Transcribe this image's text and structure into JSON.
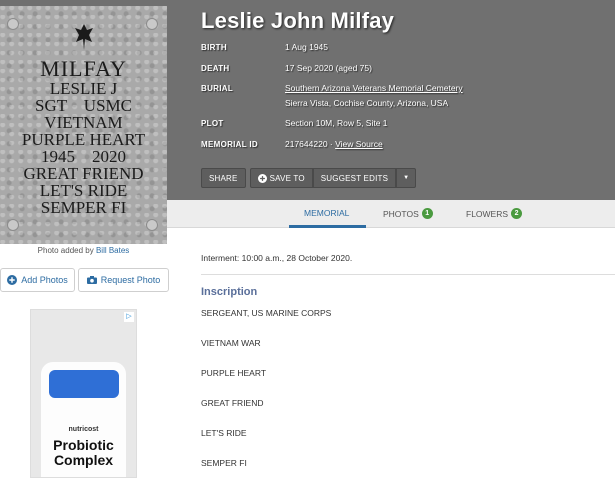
{
  "memorial": {
    "name": "Leslie John Milfay",
    "facts": [
      {
        "label": "BIRTH",
        "value": "1 Aug 1945"
      },
      {
        "label": "DEATH",
        "value": "17 Sep 2020 (aged 75)"
      },
      {
        "label": "BURIAL",
        "value": "Southern Arizona Veterans Memorial Cemetery",
        "value2": "Sierra Vista, Cochise County, Arizona, USA"
      },
      {
        "label": "PLOT",
        "value": "Section 10M, Row 5, Site 1"
      },
      {
        "label": "MEMORIAL ID",
        "value": "217644220",
        "link": "View Source"
      }
    ]
  },
  "toolbar": {
    "share": "SHARE",
    "save": "SAVE TO",
    "suggest": "SUGGEST EDITS"
  },
  "photo": {
    "headstone": [
      "MILFAY",
      "LESLIE J",
      "SGT    USMC",
      "VIETNAM",
      "PURPLE HEART",
      "1945    2020",
      "GREAT FRIEND",
      "LET'S RIDE",
      "SEMPER FI"
    ],
    "credit_prefix": "Photo added by",
    "credit_name": "Bill Bates",
    "add_photos": "Add Photos",
    "request_photo": "Request Photo"
  },
  "ad": {
    "brand": "nutricost",
    "title": "Probiotic Complex"
  },
  "tabs": [
    {
      "label": "MEMORIAL",
      "count": null,
      "active": true
    },
    {
      "label": "PHOTOS",
      "count": "1",
      "active": false
    },
    {
      "label": "FLOWERS",
      "count": "2",
      "active": false
    }
  ],
  "content": {
    "interment": "Interment: 10:00 a.m., 28 October 2020.",
    "inscription_title": "Inscription",
    "inscription_lines": [
      "SERGEANT, US MARINE CORPS",
      "VIETNAM WAR",
      "PURPLE HEART",
      "GREAT FRIEND",
      "LET'S RIDE",
      "SEMPER FI"
    ]
  },
  "colors": {
    "accent": "#2d6ca2",
    "badge": "#4a9a3f",
    "hero": "#707070"
  }
}
